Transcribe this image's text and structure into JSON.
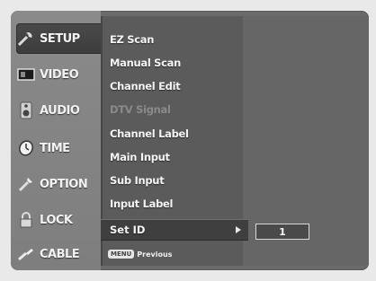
{
  "sidebar": {
    "tabs": [
      {
        "label": "SETUP",
        "icon": "wrench-icon",
        "active": true
      },
      {
        "label": "VIDEO",
        "icon": "video-screen-icon",
        "active": false
      },
      {
        "label": "AUDIO",
        "icon": "speaker-icon",
        "active": false
      },
      {
        "label": "TIME",
        "icon": "clock-icon",
        "active": false
      },
      {
        "label": "OPTION",
        "icon": "option-icon",
        "active": false
      },
      {
        "label": "LOCK",
        "icon": "lock-icon",
        "active": false
      },
      {
        "label": "CABLE",
        "icon": "cable-icon",
        "active": false
      }
    ]
  },
  "menu": {
    "items": [
      {
        "label": "EZ Scan",
        "enabled": true
      },
      {
        "label": "Manual Scan",
        "enabled": true
      },
      {
        "label": "Channel Edit",
        "enabled": true
      },
      {
        "label": "DTV Signal",
        "enabled": false
      },
      {
        "label": "Channel Label",
        "enabled": true
      },
      {
        "label": "Main Input",
        "enabled": true
      },
      {
        "label": "Sub Input",
        "enabled": true
      },
      {
        "label": "Input Label",
        "enabled": true
      }
    ],
    "selected": {
      "label": "Set ID",
      "value": "1"
    }
  },
  "hint": {
    "key": "MENU",
    "text": "Previous"
  },
  "colors": {
    "panel": "#6a6a6a",
    "sidebar": "#8a8a8a",
    "active_tab": "#3f3f3f",
    "menu_bg": "#5b5b5b"
  }
}
